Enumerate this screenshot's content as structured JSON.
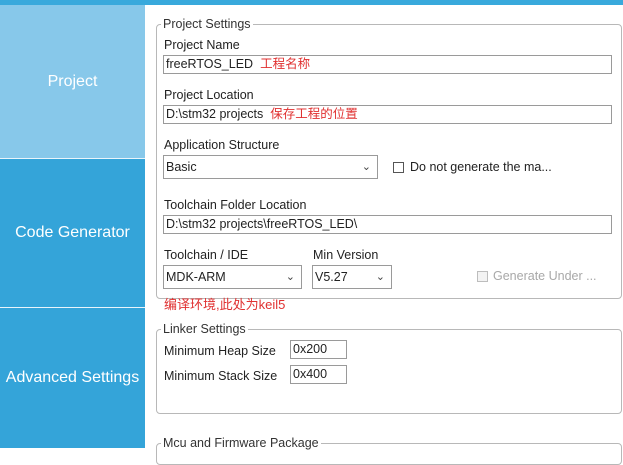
{
  "sidebar": {
    "tabs": [
      {
        "label": "Project",
        "active": true
      },
      {
        "label": "Code Generator",
        "active": false
      },
      {
        "label": "Advanced Settings",
        "active": false
      }
    ]
  },
  "project_settings": {
    "title": "Project Settings",
    "project_name": {
      "label": "Project Name",
      "value": "freeRTOS_LED",
      "note": "工程名称"
    },
    "project_location": {
      "label": "Project Location",
      "value": "D:\\stm32 projects",
      "note": "保存工程的位置"
    },
    "application_structure": {
      "label": "Application Structure",
      "value": "Basic"
    },
    "do_not_generate": {
      "label": "Do not generate the ma...",
      "checked": false
    },
    "toolchain_folder": {
      "label": "Toolchain Folder Location",
      "value": "D:\\stm32 projects\\freeRTOS_LED\\"
    },
    "toolchain_ide": {
      "label": "Toolchain / IDE",
      "value": "MDK-ARM"
    },
    "min_version": {
      "label": "Min Version",
      "value": "V5.27"
    },
    "generate_under": {
      "label": "Generate Under ...",
      "checked": false,
      "enabled": false
    }
  },
  "annotation": "编译环境,此处为keil5",
  "linker_settings": {
    "title": "Linker Settings",
    "min_heap": {
      "label": "Minimum Heap Size",
      "value": "0x200"
    },
    "min_stack": {
      "label": "Minimum Stack Size",
      "value": "0x400"
    }
  },
  "mcu_package": {
    "title": "Mcu and Firmware Package"
  },
  "colors": {
    "sidebar_active": "#87c8ea",
    "sidebar": "#34a4d9",
    "annotation": "#e03030"
  }
}
